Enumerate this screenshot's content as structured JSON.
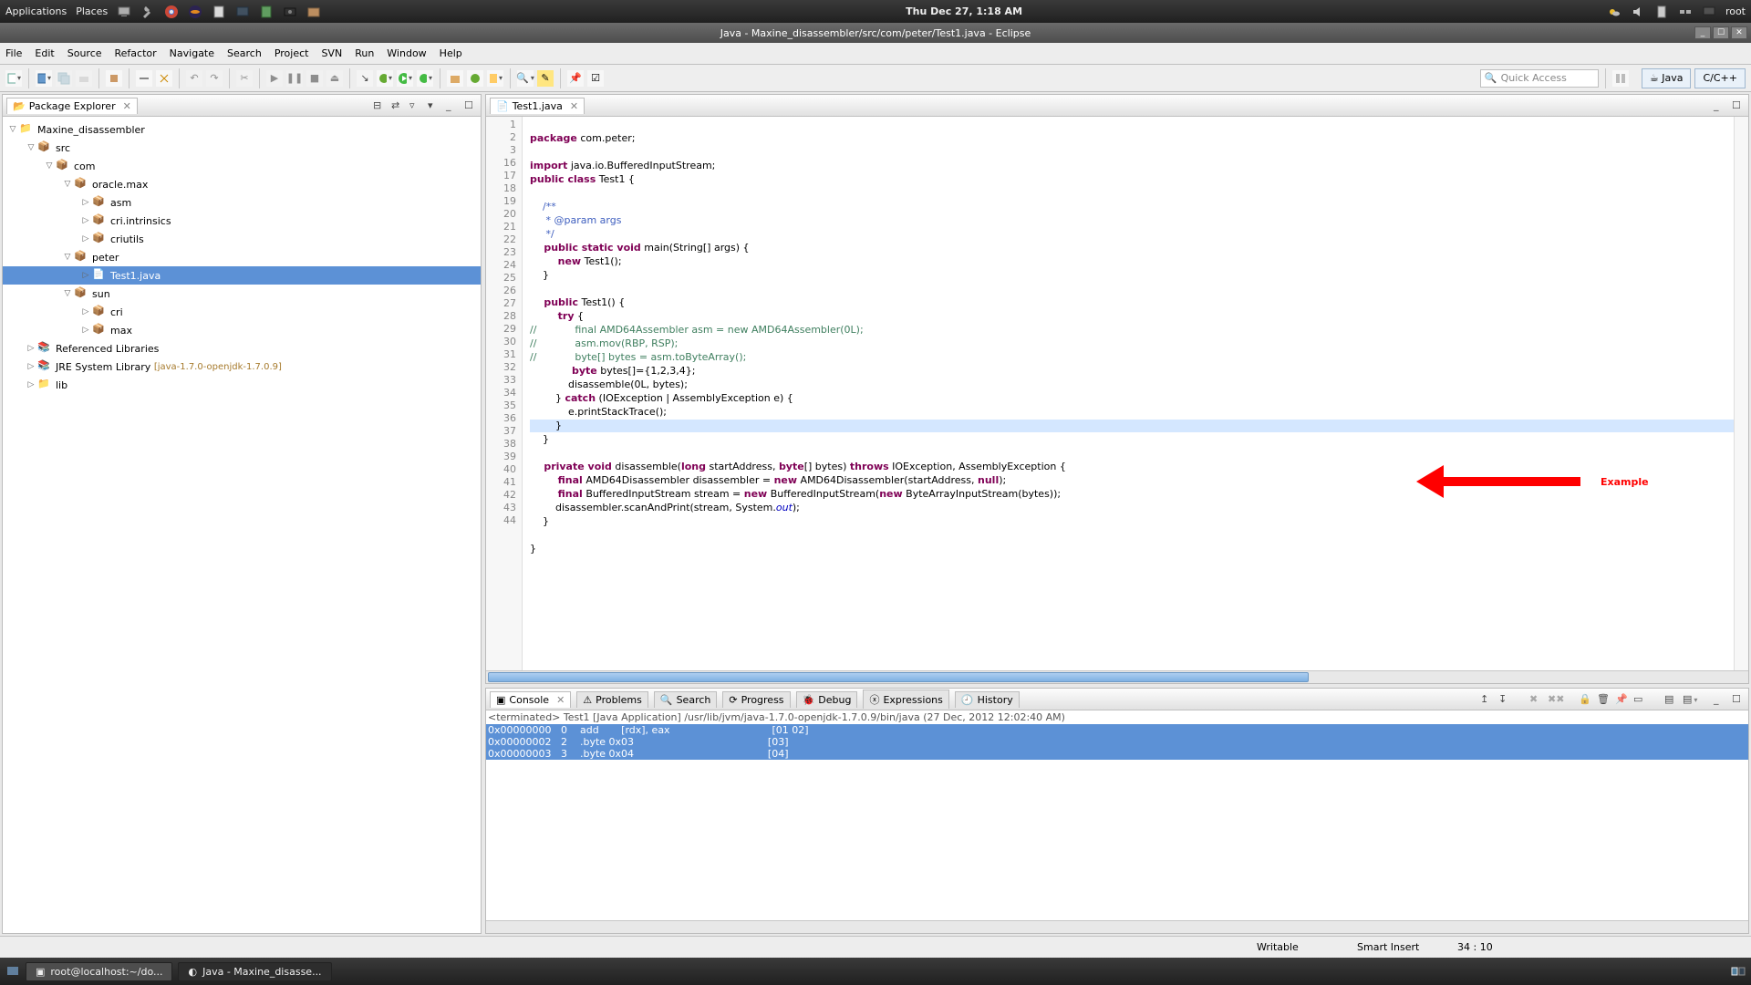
{
  "gnome": {
    "apps": "Applications",
    "places": "Places",
    "clock": "Thu Dec 27,  1:18 AM",
    "user": "root"
  },
  "window": {
    "title": "Java - Maxine_disassembler/src/com/peter/Test1.java - Eclipse"
  },
  "menus": [
    "File",
    "Edit",
    "Source",
    "Refactor",
    "Navigate",
    "Search",
    "Project",
    "SVN",
    "Run",
    "Window",
    "Help"
  ],
  "quick_access_ph": "Quick Access",
  "perspectives": {
    "java": "Java",
    "cpp": "C/C++"
  },
  "explorer": {
    "title": "Package Explorer",
    "tree": {
      "project": "Maxine_disassembler",
      "src": "src",
      "com": "com",
      "oraclemax": "oracle.max",
      "asm": "asm",
      "cri_intr": "cri.intrinsics",
      "criutils": "criutils",
      "peter": "peter",
      "test1": "Test1.java",
      "sun": "sun",
      "cri2": "cri",
      "max": "max",
      "reflib": "Referenced Libraries",
      "jre": "JRE System Library",
      "jre_ver": "[java-1.7.0-openjdk-1.7.0.9]",
      "lib": "lib"
    }
  },
  "editor": {
    "tab": "Test1.java",
    "lines": [
      1,
      2,
      3,
      16,
      17,
      18,
      19,
      20,
      21,
      22,
      23,
      24,
      25,
      26,
      27,
      28,
      29,
      30,
      31,
      32,
      33,
      34,
      35,
      36,
      37,
      38,
      39,
      40,
      41,
      42,
      43,
      44
    ],
    "code": {
      "l1": "package com.peter;",
      "l3a": "import",
      "l3b": " java.io.BufferedInputStream;",
      "l16a": "public class",
      "l16b": " Test1 {",
      "l18": "    /**",
      "l19": "     * @param args",
      "l20": "     */",
      "l21a": "    public static void",
      "l21b": " main(String[] args) {",
      "l22a": "        new",
      "l22b": " Test1();",
      "l23": "    }",
      "l25a": "    public",
      "l25b": " Test1() {",
      "l26a": "        try",
      "l26b": " {",
      "l27": "//            final AMD64Assembler asm = new AMD64Assembler(0L);",
      "l28": "//            asm.mov(RBP, RSP);",
      "l29": "//            byte[] bytes = asm.toByteArray();",
      "l30a": "            byte",
      "l30b": " bytes[]={1,2,3,4};",
      "l31": "            disassemble(0L, bytes);",
      "l32a": "        } ",
      "l32b": "catch",
      "l32c": " (IOException | AssemblyException e) {",
      "l33": "            e.printStackTrace();",
      "l34": "        }",
      "l35": "    }",
      "l37a": "    private void",
      "l37b": " disassemble(",
      "l37c": "long",
      "l37d": " startAddress, ",
      "l37e": "byte",
      "l37f": "[] bytes) ",
      "l37g": "throws",
      "l37h": " IOException, AssemblyException {",
      "l38a": "        final",
      "l38b": " AMD64Disassembler disassembler = ",
      "l38c": "new",
      "l38d": " AMD64Disassembler(startAddress, ",
      "l38e": "null",
      "l38f": ");",
      "l39a": "        final",
      "l39b": " BufferedInputStream stream = ",
      "l39c": "new",
      "l39d": " BufferedInputStream(",
      "l39e": "new",
      "l39f": " ByteArrayInputStream(bytes));",
      "l40a": "        disassembler.scanAndPrint(stream, System.",
      "l40b": "out",
      "l40c": ");",
      "l41": "    }",
      "l43": "}"
    }
  },
  "console": {
    "tabs": [
      "Console",
      "Problems",
      "Search",
      "Progress",
      "Debug",
      "Expressions",
      "History"
    ],
    "term": "<terminated> Test1 [Java Application] /usr/lib/jvm/java-1.7.0-openjdk-1.7.0.9/bin/java (27 Dec, 2012 12:02:40 AM)",
    "rows": [
      "0x00000000   0    add       [rdx], eax                                [01 02]",
      "0x00000002   2    .byte 0x03                                          [03]",
      "0x00000003   3    .byte 0x04                                          [04]"
    ]
  },
  "status": {
    "writable": "Writable",
    "insert": "Smart Insert",
    "pos": "34 : 10"
  },
  "taskbar": {
    "t1": "root@localhost:~/do...",
    "t2": "Java - Maxine_disasse..."
  },
  "overlay": {
    "label": "Example"
  }
}
